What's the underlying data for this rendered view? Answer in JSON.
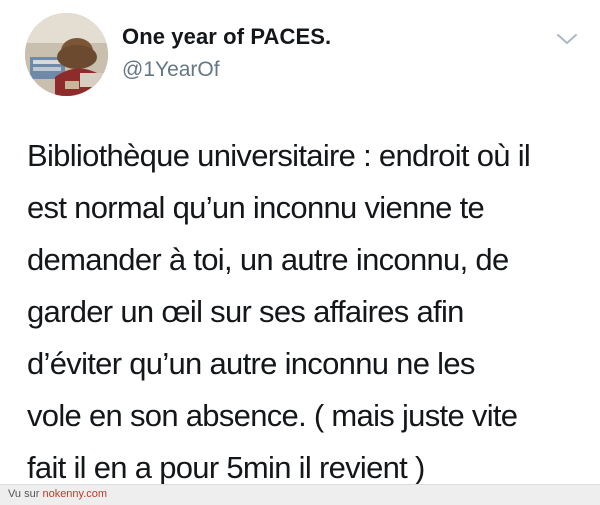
{
  "tweet": {
    "display_name": "One year of PACES.",
    "handle": "@1YearOf",
    "text": "Bibliothèque universitaire : endroit où il\nest normal qu’un inconnu vienne te\ndemander à toi, un autre inconnu, de\ngarder un œil sur ses affaires afin\nd’éviter qu’un autre inconnu ne les\nvole en son absence. ( mais juste vite\nfait il en a pour 5min il revient )",
    "menu_icon": "chevron-down-icon",
    "avatar_icon": "avatar"
  },
  "footer": {
    "prefix": "Vu sur ",
    "link": "nokenny.com",
    "link_color": "#c0392b"
  },
  "colors": {
    "text_primary": "#14171a",
    "text_secondary": "#657786",
    "footer_bg": "#eeeeee"
  }
}
